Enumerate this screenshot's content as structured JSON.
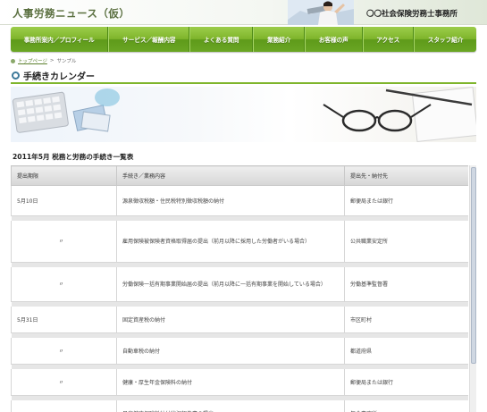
{
  "header": {
    "site_title": "人事労務ニュース（仮）",
    "office_name": "〇〇社会保険労務士事務所"
  },
  "nav": {
    "items": [
      {
        "label": "事務所案内／プロフィール"
      },
      {
        "label": "サービス／報酬内容"
      },
      {
        "label": "よくある質問"
      },
      {
        "label": "業務紹介"
      },
      {
        "label": "お客様の声"
      },
      {
        "label": "アクセス"
      },
      {
        "label": "スタッフ紹介"
      }
    ]
  },
  "breadcrumb": {
    "home": "トップページ",
    "separator": ">",
    "current": "サンプル"
  },
  "page_title": "手続きカレンダー",
  "subheading": "2011年5月 税務と労務の手続き一覧表",
  "table": {
    "headers": [
      "提出期限",
      "手続き／業務内容",
      "提出先・納付先"
    ],
    "rows": [
      {
        "date": "5月10日",
        "content": "源泉徴収税額・住民税特別徴収税額の納付",
        "destination": "郵便局または銀行",
        "height": 34
      },
      {
        "date": "〃",
        "content": "雇用保険被保険者資格取得届の提出（前月以降に採用した労働者がいる場合）",
        "destination": "公共職業安定所",
        "height": 47
      },
      {
        "date": "〃",
        "content": "労働保険一括有期事業開始届の提出（前月以降に一括有期事業を開始している場合）",
        "destination": "労働基準監督署",
        "height": 39
      },
      {
        "date": "5月31日",
        "content": "固定資産税の納付",
        "destination": "市区町村",
        "height": 30
      },
      {
        "date": "〃",
        "content": "自動車税の納付",
        "destination": "都道府県",
        "height": 30
      },
      {
        "date": "〃",
        "content": "健康・厚生年金保険料の納付",
        "destination": "郵便局または銀行",
        "height": 30
      },
      {
        "date": "〃",
        "content": "日雇健康保険料納付状況報告書の提出",
        "destination": "年金事務所",
        "height": 30
      }
    ]
  },
  "colors": {
    "nav_green": "#7fb52c",
    "title_text": "#5a6f3f"
  }
}
